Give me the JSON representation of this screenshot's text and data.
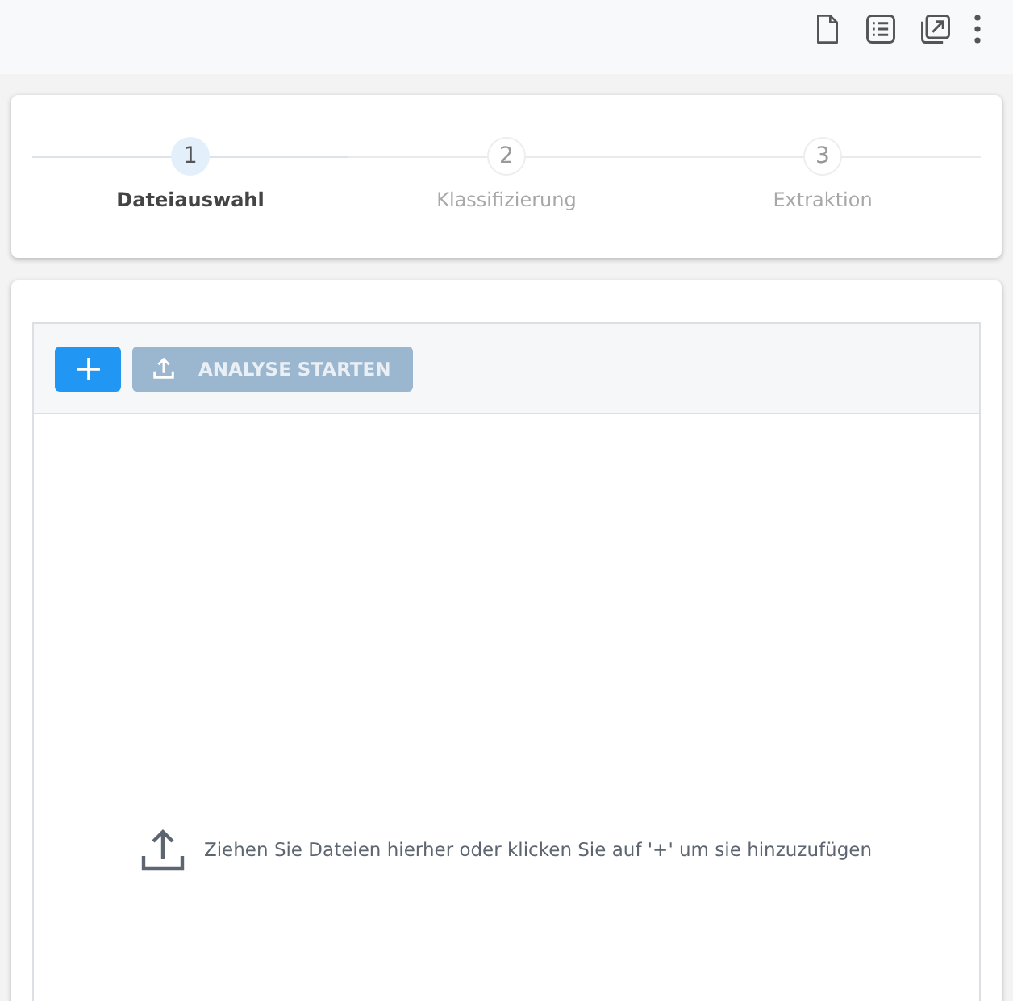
{
  "toolbar": {
    "icons": [
      {
        "kind": "document"
      },
      {
        "kind": "list"
      },
      {
        "kind": "open-external"
      },
      {
        "kind": "more"
      }
    ]
  },
  "stepper": {
    "steps": [
      {
        "number": "1",
        "label": "Dateiauswahl",
        "selected": true
      },
      {
        "number": "2",
        "label": "Klassifizierung",
        "selected": false
      },
      {
        "number": "3",
        "label": "Extraktion",
        "selected": false
      }
    ]
  },
  "uploader": {
    "add_button": {
      "disabled": false
    },
    "analyse_button": {
      "label": "ANALYSE STARTEN",
      "disabled": true
    },
    "hint": "Ziehen Sie Dateien hierher oder klicken Sie auf '+' um sie hinzuzufügen"
  }
}
